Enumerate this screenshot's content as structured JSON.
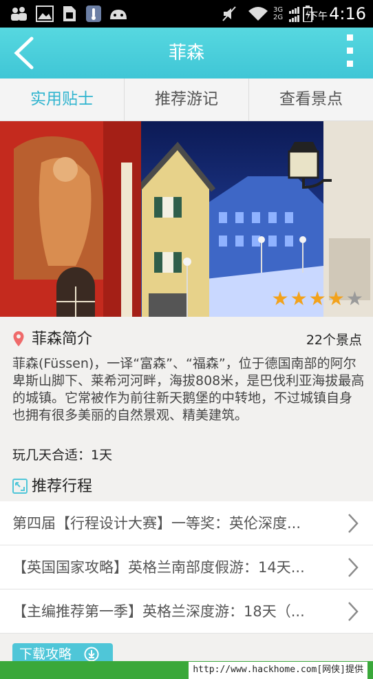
{
  "status_bar": {
    "ampm": "下午",
    "time": "4:16",
    "network_label": "3G 2G",
    "icons": [
      "users-icon",
      "image-icon",
      "sim-icon",
      "thermometer-icon",
      "android-icon",
      "mute-icon",
      "wifi-icon",
      "signal-icon",
      "battery-icon"
    ]
  },
  "header": {
    "title": "菲森",
    "back_icon": "chevron-left-icon",
    "more_icon": "more-vertical-icon"
  },
  "tabs": [
    {
      "label": "实用贴士",
      "active": true
    },
    {
      "label": "推荐游记",
      "active": false
    },
    {
      "label": "查看景点",
      "active": false
    }
  ],
  "banner": {
    "rating": 4,
    "rating_max": 5,
    "accent": "#f2a21c"
  },
  "intro": {
    "title": "菲森简介",
    "count": "22个景点",
    "text": "菲森(Füssen)，一译“富森”、“福森”，位于德国南部的阿尔卑斯山脚下、莱希河河畔，海拔808米，是巴伐利亚海拔最高的城镇。它常被作为前往新天鹅堡的中转地，不过城镇自身也拥有很多美丽的自然景观、精美建筑。",
    "days": "玩几天合适：1天"
  },
  "recommend": {
    "title": "推荐行程",
    "items": [
      {
        "label": "第四届【行程设计大赛】一等奖：英伦深度..."
      },
      {
        "label": "【英国国家攻略】英格兰南部度假游：14天..."
      },
      {
        "label": "【主编推荐第一季】英格兰深度游：18天（..."
      }
    ]
  },
  "download": {
    "label": "下载攻略"
  },
  "footer": {
    "text": "http://www.hackhome.com[网侠]提供"
  },
  "colors": {
    "header": "#4fd0dc",
    "active_tab": "#2fb4cf",
    "footer": "#3aa83a"
  }
}
